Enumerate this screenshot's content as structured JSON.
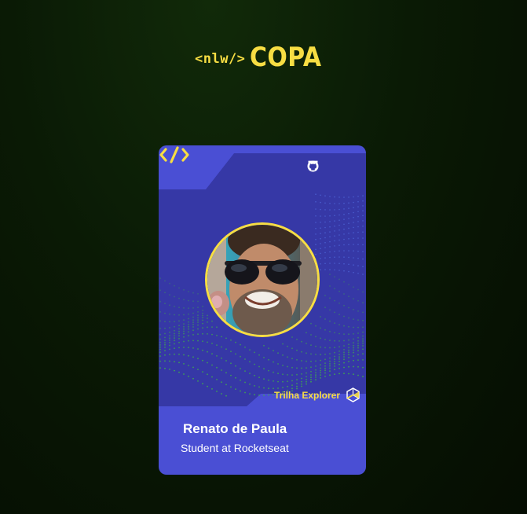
{
  "logo": {
    "tag_text": "<nlw/>",
    "word_text": "COPA"
  },
  "card": {
    "header_icon": "code-brackets-icon",
    "tech_icons": [
      "html5-icon",
      "css3-icon",
      "github-icon"
    ],
    "badge_label": "Trilha Explorer",
    "badge_icon": "explorer-hexagon-icon",
    "name": "Renato de Paula",
    "role": "Student at Rocketseat"
  },
  "colors": {
    "background": "#0a1a05",
    "card": "#4a4fd4",
    "card_dark": "#3638a6",
    "accent": "#f7dd43",
    "dots": "#3fae4a"
  }
}
